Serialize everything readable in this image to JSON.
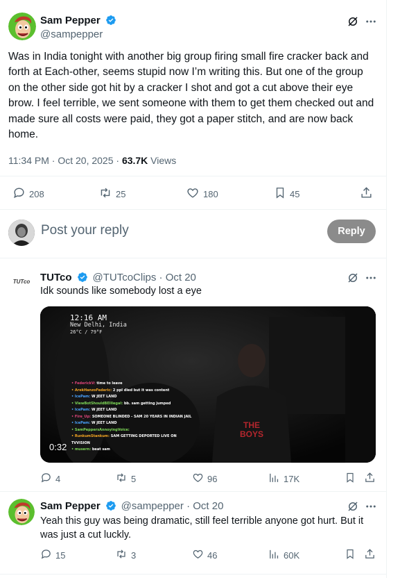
{
  "main_post": {
    "author_name": "Sam Pepper",
    "handle": "@sampepper",
    "text": "Was in India tonight with another big group firing small fire cracker back and forth at Each-other, seems stupid now I’m writing this. But one of the group on the other side got hit by a cracker I shot and got a cut above their eye brow. I feel terrible, we sent someone with them to get them checked out and made sure all costs were paid, they got a paper stitch, and are now back home.",
    "time": "11:34 PM · Oct 20, 2025 · ",
    "views_count": "63.7K",
    "views_label": " Views",
    "replies": "208",
    "reposts": "25",
    "likes": "180",
    "bookmarks": "45"
  },
  "composer": {
    "placeholder": "Post your reply",
    "reply_button": "Reply"
  },
  "reply1": {
    "author_name": "TUTco",
    "handle_date": "@TUTcoClips · Oct 20",
    "avatar_text": "TUTco",
    "text": "Idk sounds like somebody lost a eye",
    "video": {
      "time": "12:16 AM",
      "location": "New Delhi, India",
      "temp": "26°C / 79°F",
      "duration": "0:32",
      "shirt_text": "THE BOYS",
      "chat": [
        {
          "user": "FederickV:",
          "msg": "time to leave",
          "color": "#e0457b"
        },
        {
          "user": "ArekHanzoFederic:",
          "msg": "2 ppl died but it was content",
          "color": "#f5a623"
        },
        {
          "user": "IcePam:",
          "msg": "W JEET LAND",
          "color": "#4aa3ff"
        },
        {
          "user": "ViewBotShouldBEIllegal:",
          "msg": "bb. sam getting jumped",
          "color": "#7ed957"
        },
        {
          "user": "IcePam:",
          "msg": "W JEET LAND",
          "color": "#4aa3ff"
        },
        {
          "user": "Fire_Up:",
          "msg": "SOMEONE BLINDED - SAM 20 YEARS IN INDIAN JAIL",
          "color": "#e0457b"
        },
        {
          "user": "IcePam:",
          "msg": "W JEET LAND",
          "color": "#4aa3ff"
        },
        {
          "user": "SamPeppersAnnoyingVoice:",
          "msg": "",
          "color": "#7ed957"
        },
        {
          "user": "RunkumStankum:",
          "msg": "SAM GETTING DEPORTED LIVE ON",
          "color": "#f5a623"
        },
        {
          "user": "",
          "msg": "TVVISION",
          "color": "#ffffff"
        },
        {
          "user": "musern:",
          "msg": "beat sam",
          "color": "#7ed957"
        }
      ]
    },
    "replies": "4",
    "reposts": "5",
    "likes": "96",
    "views": "17K"
  },
  "reply2": {
    "author_name": "Sam Pepper",
    "handle_date": "@sampepper · Oct 20",
    "text": "Yeah this guy was being dramatic, still feel terrible anyone got hurt. But it was just a cut luckly.",
    "replies": "15",
    "reposts": "3",
    "likes": "46",
    "views": "60K"
  },
  "colors": {
    "verified": "#1d9bf0",
    "muted": "#536471",
    "reply_button_bg": "#8b8b8b"
  },
  "icons": [
    "grok-icon",
    "more-icon",
    "reply-icon",
    "repost-icon",
    "like-icon",
    "bookmark-icon",
    "share-icon",
    "views-icon",
    "verified-icon"
  ]
}
